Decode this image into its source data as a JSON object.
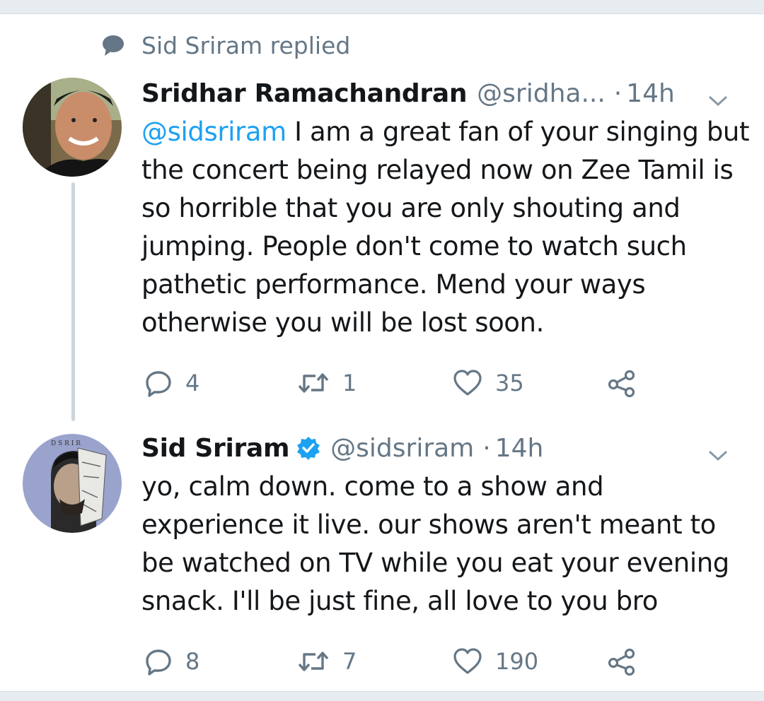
{
  "context": {
    "text": "Sid Sriram replied",
    "icon": "speech-bubble-icon"
  },
  "tweets": [
    {
      "display_name": "Sridhar Ramachandran",
      "handle": "@sridha...",
      "separator": "·",
      "time": "14h",
      "verified": false,
      "mention": "@sidsriram",
      "text": " I am a great fan of your singing but the concert being relayed now on Zee Tamil is so horrible that you are only shouting and jumping. People don't come to watch such pathetic performance. Mend your ways otherwise you will be lost soon.",
      "replies": "4",
      "retweets": "1",
      "likes": "35"
    },
    {
      "display_name": "Sid Sriram",
      "handle": "@sidsriram",
      "separator": "·",
      "time": "14h",
      "verified": true,
      "text": "yo, calm down. come to a show and experience it live. our shows aren't meant to be watched on TV while you eat your evening snack. I'll be just fine, all love to you bro",
      "replies": "8",
      "retweets": "7",
      "likes": "190"
    }
  ],
  "colors": {
    "text_primary": "#14171a",
    "text_secondary": "#657786",
    "accent": "#1da1f2",
    "thread_line": "#ccd6dd",
    "separator_bg": "#e6ecf0"
  }
}
